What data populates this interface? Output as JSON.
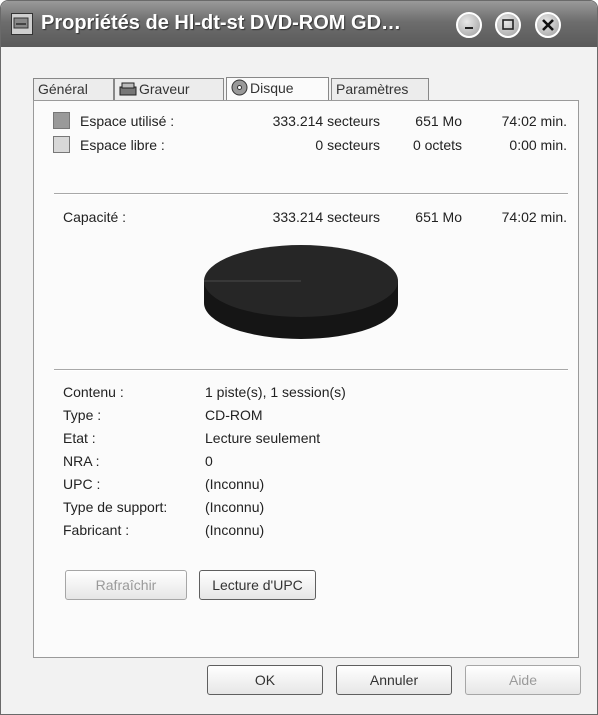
{
  "window": {
    "title": "Propriétés de Hl-dt-st DVD-ROM GD…",
    "colors": {
      "titlebar": "#6d6d6d",
      "used": "#1f1f1f",
      "free": "#d8d8d8"
    }
  },
  "tabs": [
    {
      "label": "Général",
      "icon": ""
    },
    {
      "label": "Graveur",
      "icon": "burner-icon"
    },
    {
      "label": "Disque",
      "icon": "disc-icon"
    },
    {
      "label": "Paramètres",
      "icon": ""
    }
  ],
  "active_tab": "Disque",
  "space": {
    "used": {
      "label": "Espace utilisé :",
      "sectors": "333.214 secteurs",
      "size": "651 Mo",
      "time": "74:02 min."
    },
    "free": {
      "label": "Espace libre :",
      "sectors": "0 secteurs",
      "size": "0 octets",
      "time": "0:00 min."
    }
  },
  "capacity": {
    "label": "Capacité :",
    "sectors": "333.214 secteurs",
    "size": "651 Mo",
    "time": "74:02 min."
  },
  "disc_usage_fraction": 1.0,
  "info": [
    {
      "label": "Contenu :",
      "value": "1 piste(s), 1 session(s)"
    },
    {
      "label": "Type :",
      "value": "CD-ROM"
    },
    {
      "label": "Etat :",
      "value": "Lecture seulement"
    },
    {
      "label": "NRA :",
      "value": "0"
    },
    {
      "label": "UPC :",
      "value": "(Inconnu)"
    },
    {
      "label": "Type de support:",
      "value": "(Inconnu)"
    },
    {
      "label": "Fabricant :",
      "value": "(Inconnu)"
    }
  ],
  "buttons": {
    "refresh": "Rafraîchir",
    "read_upc": "Lecture d'UPC",
    "ok": "OK",
    "cancel": "Annuler",
    "help": "Aide"
  }
}
